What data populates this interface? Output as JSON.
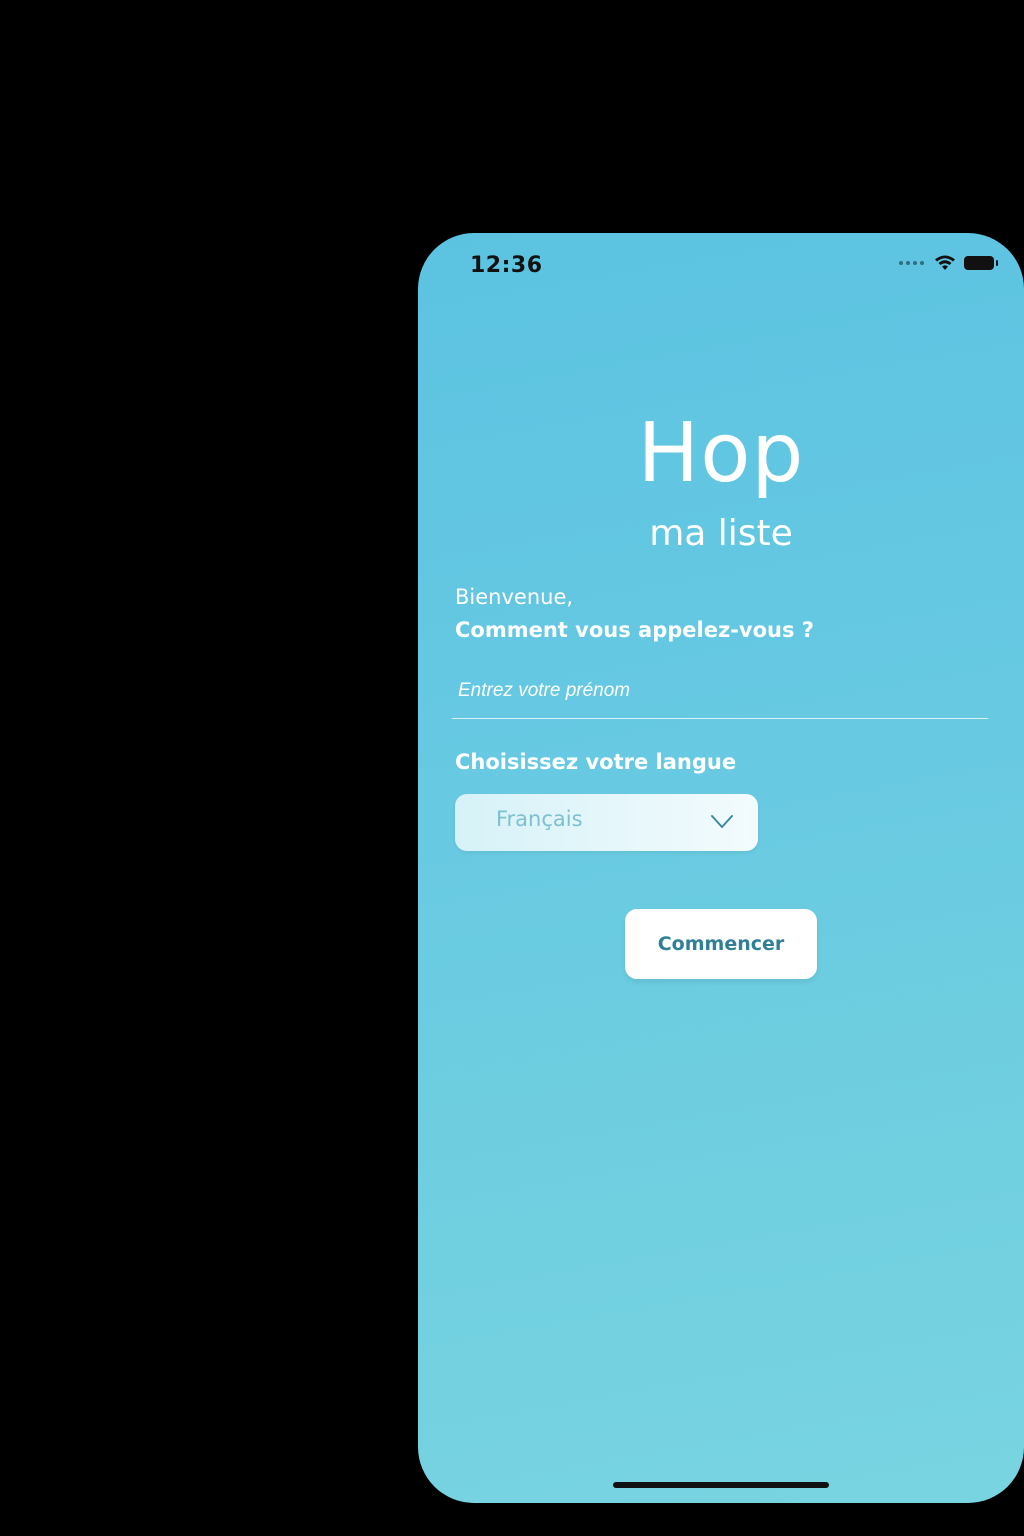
{
  "status_bar": {
    "time": "12:36"
  },
  "brand": {
    "title": "Hop",
    "subtitle": "ma liste"
  },
  "welcome": {
    "greeting": "Bienvenue,",
    "question": "Comment vous appelez-vous ?"
  },
  "name_input": {
    "placeholder": "Entrez votre prénom",
    "value": ""
  },
  "language": {
    "label": "Choisissez votre langue",
    "selected": "Français"
  },
  "actions": {
    "start_label": "Commencer"
  },
  "colors": {
    "background_gradient_top": "#5bc3e1",
    "background_gradient_bottom": "#79d4e1",
    "text": "#ffffff",
    "button_text": "#2f7f96",
    "select_text": "#7ebfd0"
  },
  "icons": {
    "wifi": "wifi-icon",
    "battery": "battery-icon",
    "signal": "signal-icon",
    "dropdown": "chevron-down-icon"
  }
}
